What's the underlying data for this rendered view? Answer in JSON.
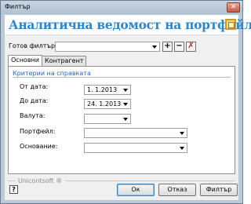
{
  "window": {
    "title": "Филтър",
    "close_glyph": "✕"
  },
  "header": {
    "title": "Аналитична ведомост на портфейл",
    "icon": "report-icon"
  },
  "ready_filter": {
    "label": "Готов филтър:",
    "value": ""
  },
  "filter_actions": {
    "add": "+",
    "remove": "−",
    "clear": "✗"
  },
  "tabs": [
    {
      "label": "Основни",
      "active": true
    },
    {
      "label": "Контрагент",
      "active": false
    }
  ],
  "criteria": {
    "title": "Критерии на справката",
    "from_date": {
      "label": "От дата:",
      "value": "1. 1.2013"
    },
    "to_date": {
      "label": "До дата:",
      "value": "24. 1.2013"
    },
    "currency": {
      "label": "Валута:",
      "value": ""
    },
    "portfolio": {
      "label": "Портфейл:",
      "value": ""
    },
    "basis": {
      "label": "Основание:",
      "value": ""
    }
  },
  "footer": {
    "brand": "Unicontsoft ®",
    "help": "?",
    "ok": "Ок",
    "cancel": "Отказ",
    "filter": "Филтър"
  },
  "colors": {
    "accent_title": "#2f86c9",
    "section_title": "#2b5fbf"
  }
}
